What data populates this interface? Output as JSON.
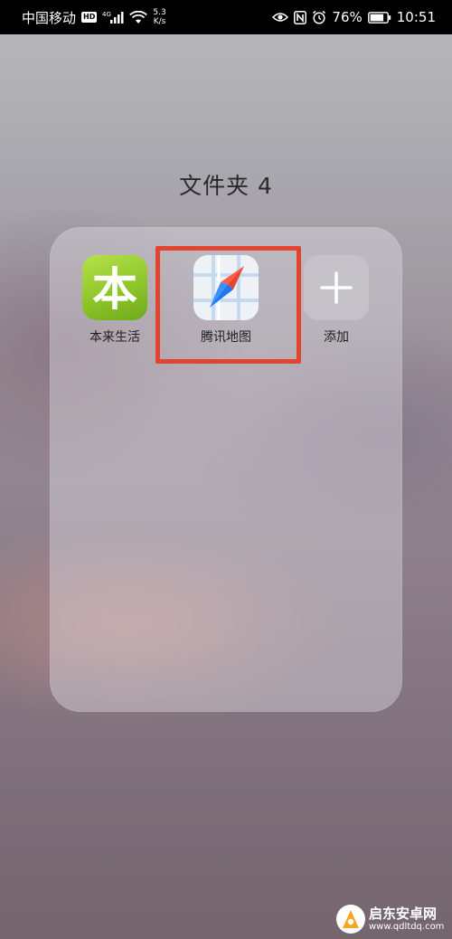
{
  "status_bar": {
    "carrier": "中国移动",
    "hd": "HD",
    "network": "4G",
    "speed_value": "5.3",
    "speed_unit": "K/s",
    "battery_percent": "76%",
    "time": "10:51"
  },
  "folder": {
    "title": "文件夹 4",
    "apps": [
      {
        "label": "本来生活",
        "icon": "benlai-app-icon",
        "glyph": "本",
        "color": "#8ec62a"
      },
      {
        "label": "腾讯地图",
        "icon": "tencent-map-app-icon",
        "color": "#1e78f0"
      },
      {
        "label": "添加",
        "icon": "add-icon"
      }
    ]
  },
  "highlight": {
    "color": "#e2442f",
    "target": "腾讯地图"
  },
  "watermark": {
    "name": "启东安卓网",
    "url": "www.qdltdq.com"
  }
}
